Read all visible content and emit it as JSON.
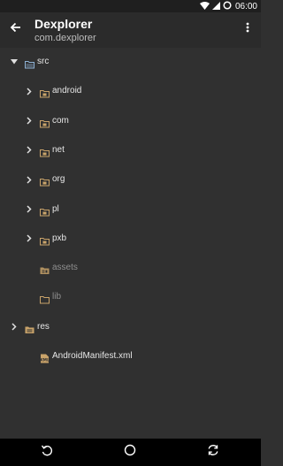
{
  "status_bar": {
    "time": "06:00"
  },
  "app_bar": {
    "title": "Dexplorer",
    "subtitle": "com.dexplorer"
  },
  "tree": [
    {
      "label": "src",
      "level": 0,
      "state": "expanded",
      "icon": "folder-open-blue-icon",
      "dim": false
    },
    {
      "label": "android",
      "level": 1,
      "state": "collapsed",
      "icon": "package-folder-icon",
      "dim": false
    },
    {
      "label": "com",
      "level": 1,
      "state": "collapsed",
      "icon": "package-folder-icon",
      "dim": false
    },
    {
      "label": "net",
      "level": 1,
      "state": "collapsed",
      "icon": "package-folder-icon",
      "dim": false
    },
    {
      "label": "org",
      "level": 1,
      "state": "collapsed",
      "icon": "package-folder-icon",
      "dim": false
    },
    {
      "label": "pl",
      "level": 1,
      "state": "collapsed",
      "icon": "package-folder-icon",
      "dim": false
    },
    {
      "label": "pxb",
      "level": 1,
      "state": "collapsed",
      "icon": "package-folder-icon",
      "dim": false
    },
    {
      "label": "assets",
      "level": 1,
      "state": "none",
      "icon": "assets-folder-icon",
      "dim": true
    },
    {
      "label": "lib",
      "level": 1,
      "state": "none",
      "icon": "lib-folder-icon",
      "dim": true
    },
    {
      "label": "res",
      "level": 0,
      "state": "collapsed",
      "icon": "res-folder-icon",
      "dim": false
    },
    {
      "label": "AndroidManifest.xml",
      "level": 1,
      "state": "none",
      "icon": "xml-file-icon",
      "dim": false
    }
  ],
  "colors": {
    "folder": "#c9a36a",
    "src_folder": "#8fb3d6",
    "background": "#303030",
    "app_bar": "#2b2b2b"
  }
}
